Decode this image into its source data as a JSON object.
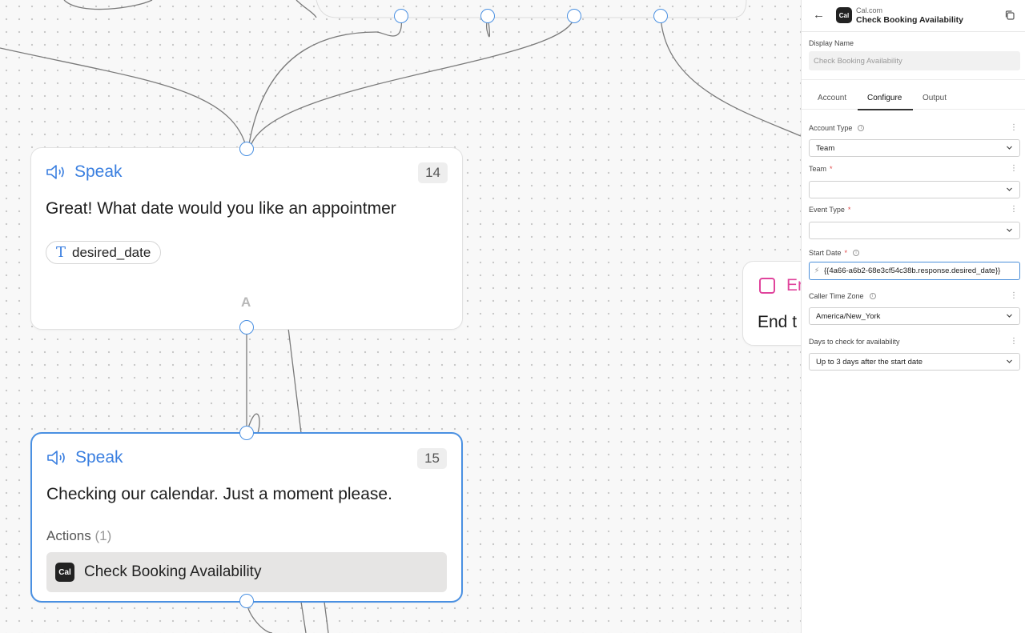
{
  "canvas": {
    "node14": {
      "title": "Speak",
      "number": "14",
      "text": "Great! What date would you like an appointmer",
      "variable": "desired_date",
      "branch_label": "A"
    },
    "node15": {
      "title": "Speak",
      "number": "15",
      "text": "Checking our calendar. Just a moment please.",
      "actions_label": "Actions",
      "actions_count": "(1)",
      "action_logo": "Cal",
      "action_label": "Check Booking Availability"
    },
    "end_node": {
      "title": "En",
      "text": "End t"
    }
  },
  "panel": {
    "header": {
      "logo": "Cal",
      "subtitle": "Cal.com",
      "title": "Check Booking Availability",
      "back_icon": "back-arrow-icon",
      "copy_icon": "copy-icon"
    },
    "display_name": {
      "label": "Display Name",
      "value": "Check Booking Availability"
    },
    "tabs": [
      {
        "label": "Account",
        "active": false
      },
      {
        "label": "Configure",
        "active": true
      },
      {
        "label": "Output",
        "active": false
      }
    ],
    "fields": {
      "account_type": {
        "label": "Account Type",
        "value": "Team"
      },
      "team": {
        "label": "Team",
        "required": "*",
        "value": ""
      },
      "event_type": {
        "label": "Event Type",
        "required": "*",
        "value": ""
      },
      "start_date": {
        "label": "Start Date",
        "required": "*",
        "value": "{{4a66-a6b2-68e3cf54c38b.response.desired_date}}"
      },
      "caller_time_zone": {
        "label": "Caller Time Zone",
        "value": "America/New_York"
      },
      "days_to_check": {
        "label": "Days to check for availability",
        "value": "Up to 3 days after the start date"
      }
    }
  },
  "colors": {
    "accent": "#4a90e2",
    "speak_title": "#3a7fe0",
    "end_node": "#e0449c",
    "required": "#e04848"
  }
}
